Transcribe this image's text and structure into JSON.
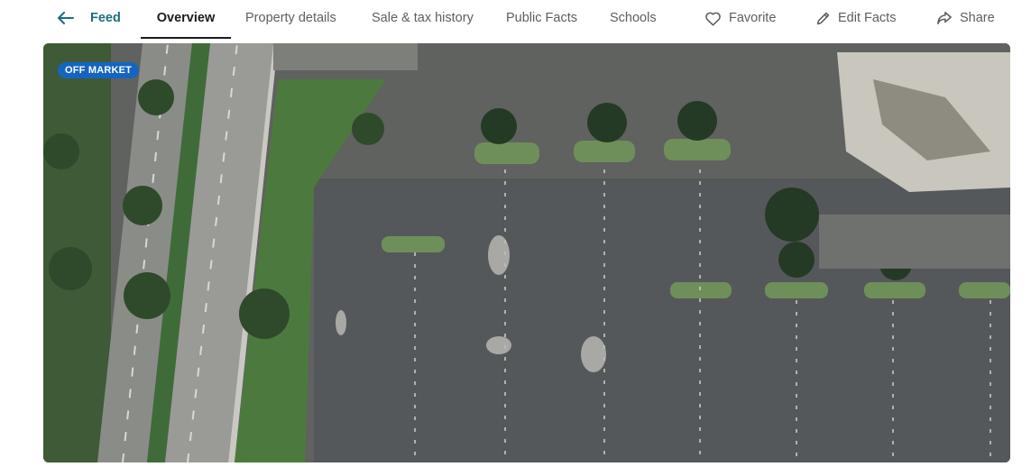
{
  "nav": {
    "back_label": "Feed",
    "tabs": [
      {
        "label": "Overview",
        "active": true
      },
      {
        "label": "Property details",
        "active": false
      },
      {
        "label": "Sale & tax history",
        "active": false
      },
      {
        "label": "Public Facts",
        "active": false
      },
      {
        "label": "Schools",
        "active": false
      }
    ],
    "actions": [
      {
        "label": "Favorite",
        "icon": "heart-icon"
      },
      {
        "label": "Edit Facts",
        "icon": "pencil-icon"
      },
      {
        "label": "Share",
        "icon": "share-icon"
      }
    ]
  },
  "listing": {
    "status_badge": "OFF MARKET",
    "photo_description": "Aerial satellite view of a parking lot next to a divided road"
  },
  "colors": {
    "accent": "#1c6e7d",
    "badge": "#1565c0",
    "active_tab": "#1b1b1b",
    "muted_text": "#5e5e5e"
  }
}
